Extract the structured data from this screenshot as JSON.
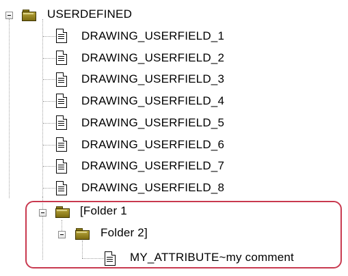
{
  "tree": {
    "root": {
      "label": "USERDEFINED",
      "expanded": true,
      "icon": "folder-icon",
      "children": [
        {
          "label": "DRAWING_USERFIELD_1",
          "icon": "document-icon"
        },
        {
          "label": "DRAWING_USERFIELD_2",
          "icon": "document-icon"
        },
        {
          "label": "DRAWING_USERFIELD_3",
          "icon": "document-icon"
        },
        {
          "label": "DRAWING_USERFIELD_4",
          "icon": "document-icon"
        },
        {
          "label": "DRAWING_USERFIELD_5",
          "icon": "document-icon"
        },
        {
          "label": "DRAWING_USERFIELD_6",
          "icon": "document-icon"
        },
        {
          "label": "DRAWING_USERFIELD_7",
          "icon": "document-icon"
        },
        {
          "label": "DRAWING_USERFIELD_8",
          "icon": "document-icon"
        }
      ]
    },
    "folder1": {
      "label": "[Folder 1",
      "expanded": true,
      "icon": "folder-icon"
    },
    "folder2": {
      "label": "Folder 2]",
      "expanded": true,
      "icon": "folder-icon"
    },
    "attribute": {
      "label": "MY_ATTRIBUTE~my comment",
      "icon": "document-icon"
    }
  },
  "colors": {
    "highlight_border": "#c8384e",
    "folder": "#9a8a22",
    "connector": "#a0a0a0"
  }
}
